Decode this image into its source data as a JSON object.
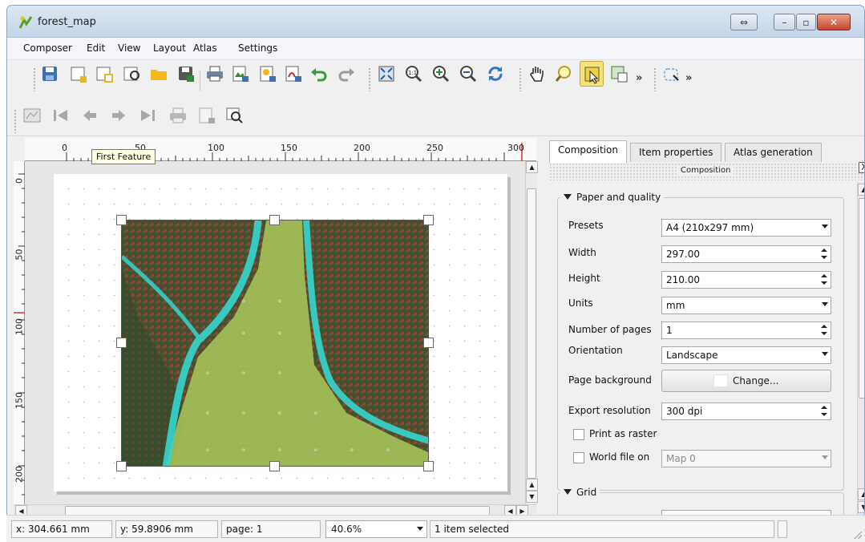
{
  "window": {
    "title": "forest_map"
  },
  "menu": [
    "Composer",
    "Edit",
    "View",
    "Layout",
    "Atlas",
    "Settings"
  ],
  "toolbar": {
    "more_label": "»"
  },
  "tooltip": {
    "text": "First Feature"
  },
  "ruler": {
    "h_labels": [
      "0",
      "50",
      "100",
      "150",
      "200",
      "250",
      "300"
    ],
    "v_labels": [
      "0",
      "50",
      "100",
      "150",
      "200"
    ]
  },
  "dock": {
    "tabs": [
      "Composition",
      "Item properties",
      "Atlas generation"
    ],
    "title": "Composition",
    "close_label": "X",
    "paper_group": {
      "title": "Paper and quality",
      "presets_label": "Presets",
      "presets_value": "A4 (210x297 mm)",
      "width_label": "Width",
      "width_value": "297.00",
      "height_label": "Height",
      "height_value": "210.00",
      "units_label": "Units",
      "units_value": "mm",
      "pages_label": "Number of pages",
      "pages_value": "1",
      "orientation_label": "Orientation",
      "orientation_value": "Landscape",
      "background_label": "Page background",
      "background_button": "Change...",
      "background_color": "#ffffff",
      "resolution_label": "Export resolution",
      "resolution_value": "300 dpi",
      "raster_label": "Print as raster",
      "raster_checked": false,
      "worldfile_label": "World file on",
      "worldfile_checked": false,
      "worldfile_value": "Map 0"
    },
    "grid_group": {
      "title": "Grid"
    }
  },
  "status": {
    "x": "x: 304.661 mm",
    "y": "y: 59.8906 mm",
    "page": "page: 1",
    "zoom": "40.6%",
    "selection": "1 item selected"
  },
  "colors": {
    "selected_tool": "#f6e27a",
    "close_button": "#c7452a",
    "river_overlay": "#35d6cf",
    "field_overlay": "#a9c95a"
  }
}
